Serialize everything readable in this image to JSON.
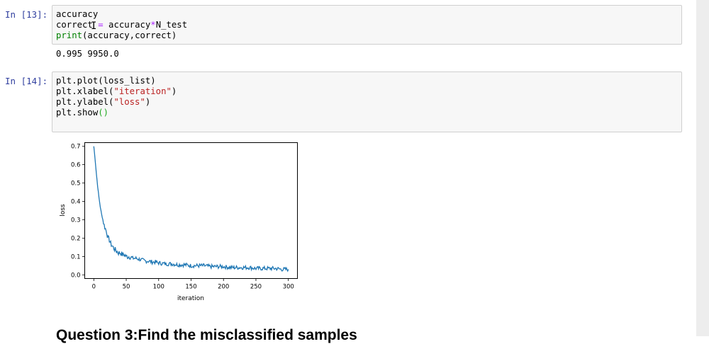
{
  "cells": [
    {
      "prompt": "In [13]:",
      "code": {
        "line1": "accuracy",
        "line2_a": "correct",
        "line2_b": " = ",
        "line2_c": "accuracy",
        "line2_d": "*",
        "line2_e": "N_test",
        "line3_a": "print",
        "line3_b": "(accuracy,correct)"
      },
      "output": "0.995 9950.0"
    },
    {
      "prompt": "In [14]:",
      "code": {
        "line1": "plt.plot(loss_list)",
        "line2_a": "plt.xlabel(",
        "line2_b": "\"iteration\"",
        "line2_c": ")",
        "line3_a": "plt.ylabel(",
        "line3_b": "\"loss\"",
        "line3_c": ")",
        "line4_a": "plt.show",
        "line4_b": "()"
      }
    }
  ],
  "heading": "Question 3:Find the misclassified samples",
  "cursor_icon": "text-cursor-icon",
  "chart_data": {
    "type": "line",
    "xlabel": "iteration",
    "ylabel": "loss",
    "xlim": [
      -14,
      314
    ],
    "ylim": [
      -0.02,
      0.72
    ],
    "xticks": [
      0,
      50,
      100,
      150,
      200,
      250,
      300
    ],
    "yticks": [
      0.0,
      0.1,
      0.2,
      0.3,
      0.4,
      0.5,
      0.6,
      0.7
    ],
    "ytick_labels": [
      "0.0",
      "0.1",
      "0.2",
      "0.3",
      "0.4",
      "0.5",
      "0.6",
      "0.7"
    ],
    "grid": false,
    "line_color": "#1f77b4",
    "series": [
      {
        "x": [
          0,
          2,
          4,
          6,
          8,
          10,
          12,
          14,
          16,
          18,
          20,
          22,
          24,
          26,
          28,
          30,
          32,
          35,
          38,
          41,
          44,
          47,
          50,
          55,
          60,
          65,
          70,
          75,
          80,
          85,
          90,
          95,
          100,
          110,
          120,
          130,
          140,
          150,
          160,
          170,
          180,
          190,
          200,
          210,
          220,
          230,
          240,
          250,
          260,
          270,
          280,
          290,
          300
        ],
        "y": [
          0.7,
          0.63,
          0.55,
          0.48,
          0.42,
          0.37,
          0.33,
          0.3,
          0.27,
          0.25,
          0.23,
          0.2,
          0.19,
          0.17,
          0.16,
          0.15,
          0.14,
          0.13,
          0.12,
          0.12,
          0.11,
          0.11,
          0.1,
          0.1,
          0.09,
          0.09,
          0.085,
          0.08,
          0.075,
          0.075,
          0.07,
          0.07,
          0.065,
          0.06,
          0.06,
          0.055,
          0.055,
          0.05,
          0.05,
          0.05,
          0.045,
          0.045,
          0.045,
          0.04,
          0.04,
          0.04,
          0.04,
          0.035,
          0.035,
          0.035,
          0.035,
          0.03,
          0.03
        ]
      }
    ]
  },
  "colors": {
    "prompt": "#303f9f",
    "cell_bg": "#f7f7f7",
    "cell_border": "#cfcfcf",
    "builtin": "#008000",
    "string": "#ba2121",
    "operator": "#aa22ff"
  }
}
